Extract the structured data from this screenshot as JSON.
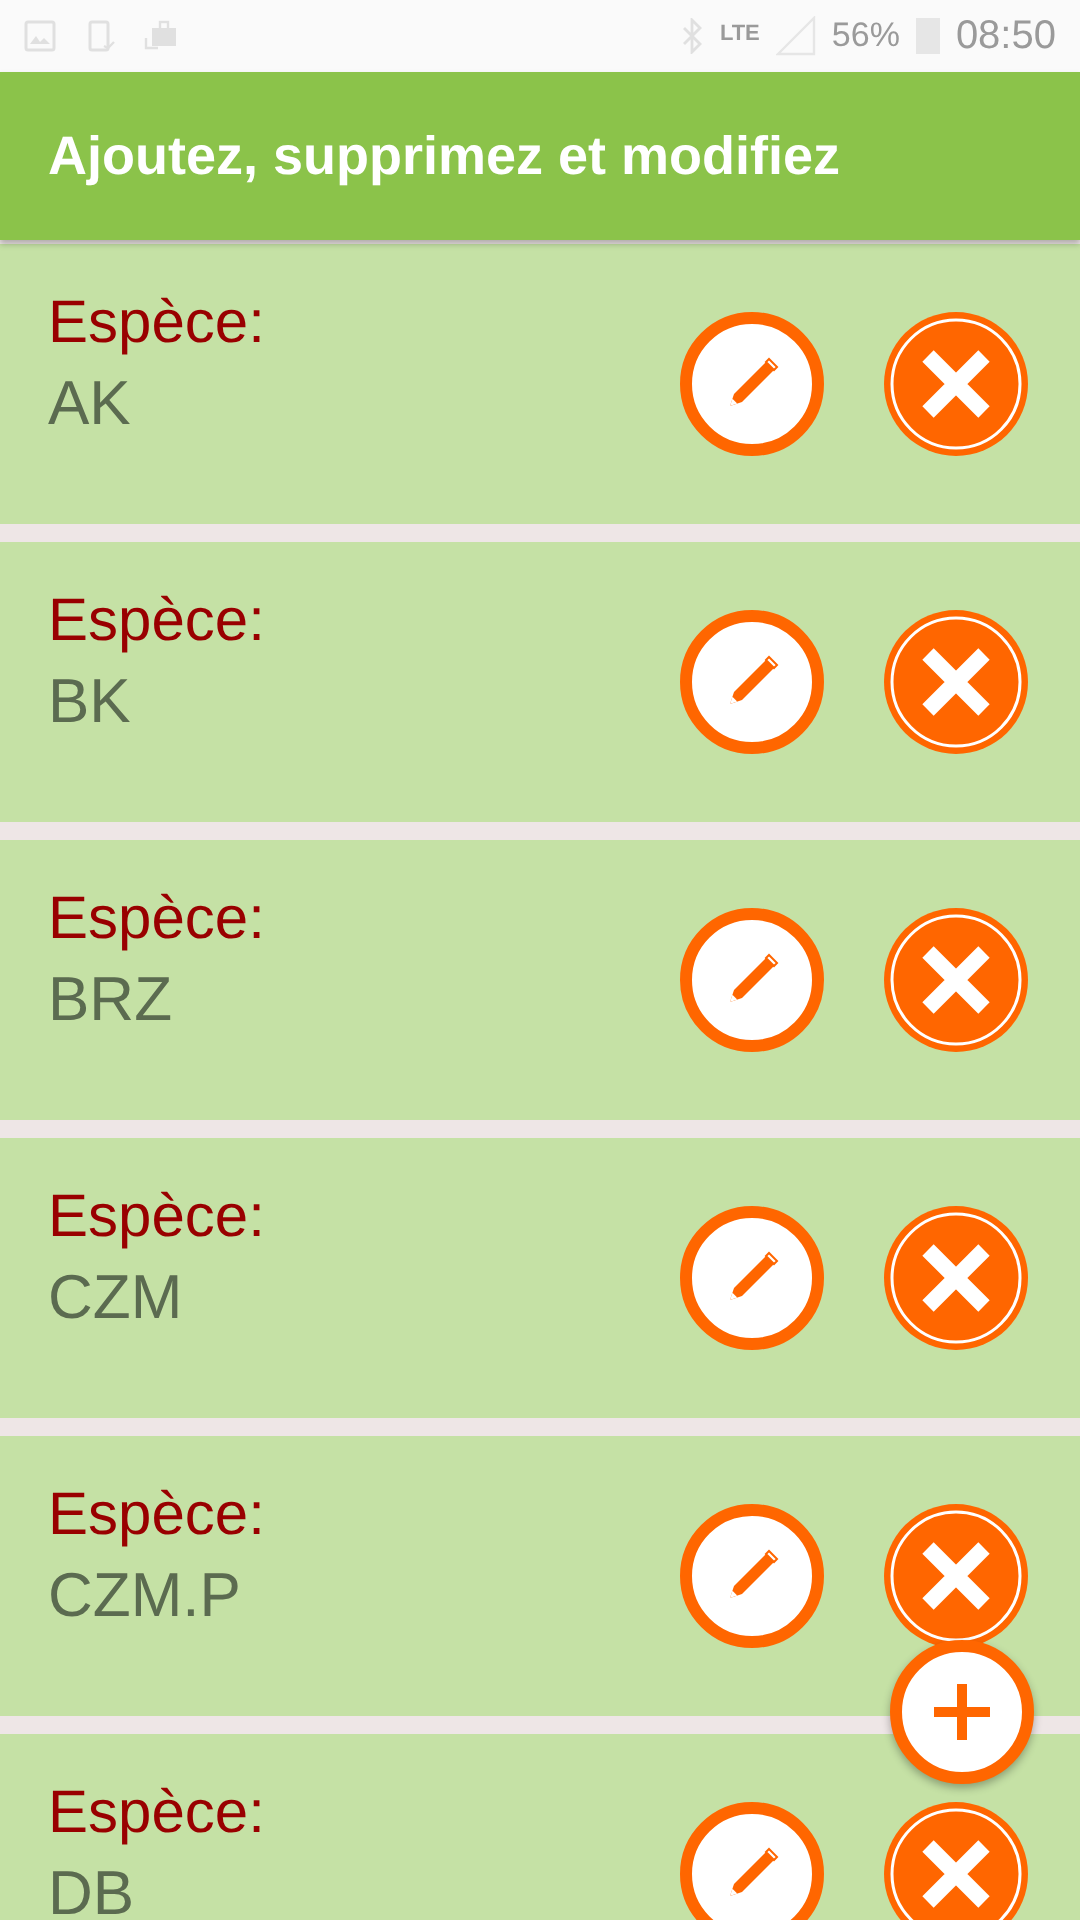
{
  "status_bar": {
    "network": "LTE",
    "battery": "56%",
    "time": "08:50"
  },
  "app_bar": {
    "title": "Ajoutez, supprimez et modifiez"
  },
  "items": [
    {
      "label": "Espèce:",
      "value": "AK"
    },
    {
      "label": "Espèce:",
      "value": "BK"
    },
    {
      "label": "Espèce:",
      "value": "BRZ"
    },
    {
      "label": "Espèce:",
      "value": "CZM"
    },
    {
      "label": "Espèce:",
      "value": "CZM.P"
    },
    {
      "label": "Espèce:",
      "value": "DB"
    }
  ]
}
